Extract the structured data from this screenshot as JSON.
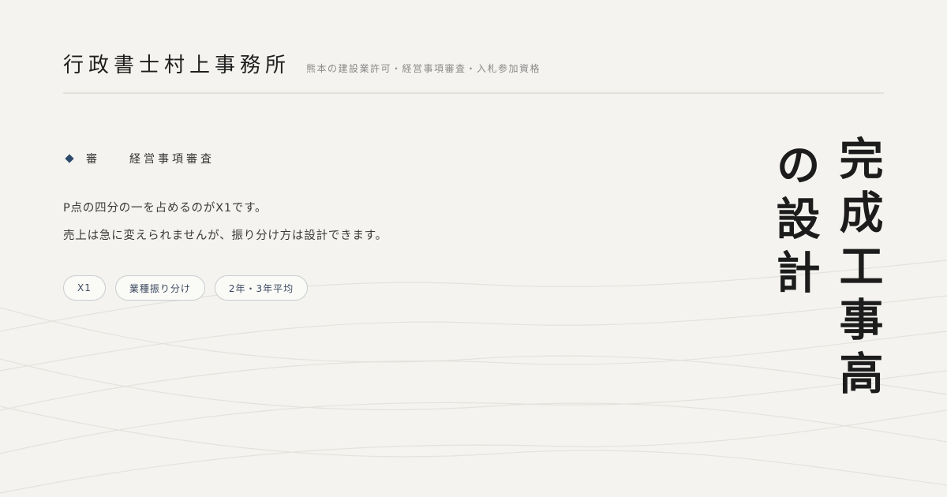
{
  "header": {
    "office_name": "行政書士村上事務所",
    "tagline": "熊本の建設業許可・経営事項審査・入札参加資格"
  },
  "category": {
    "short": "審",
    "long": "経営事項審査"
  },
  "body": {
    "line1": "P点の四分の一を占めるのがX1です。",
    "line2": "売上は急に変えられませんが、振り分け方は設計できます。"
  },
  "tags": [
    "X1",
    "業種振り分け",
    "2年・3年平均"
  ],
  "title": {
    "column1": "完成工事高",
    "column2": "の設計"
  },
  "colors": {
    "background": "#f4f3ef",
    "accent": "#2e4a6b"
  },
  "icons": {
    "bullet": "diamond-icon"
  }
}
